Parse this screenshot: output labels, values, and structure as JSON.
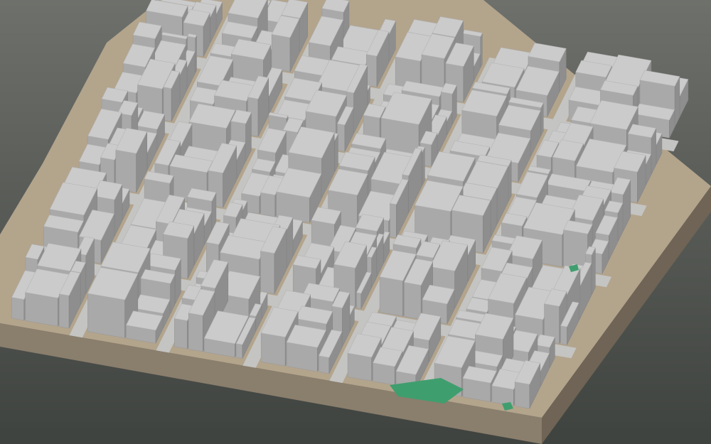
{
  "scene": {
    "kind": "3d-city-block-model",
    "view": "oblique-aerial"
  },
  "colors": {
    "background_top": "#6e706b",
    "background_bottom": "#3f433f",
    "base_side": "#8a7e6d",
    "base_side_dark": "#6f6455",
    "ground": "#b3a48c",
    "street": "#c4c4c2",
    "building_top": "#cbcbcb",
    "building_left": "#a9a9a9",
    "building_right": "#8e8e8e",
    "park": "#3f9e6e"
  }
}
